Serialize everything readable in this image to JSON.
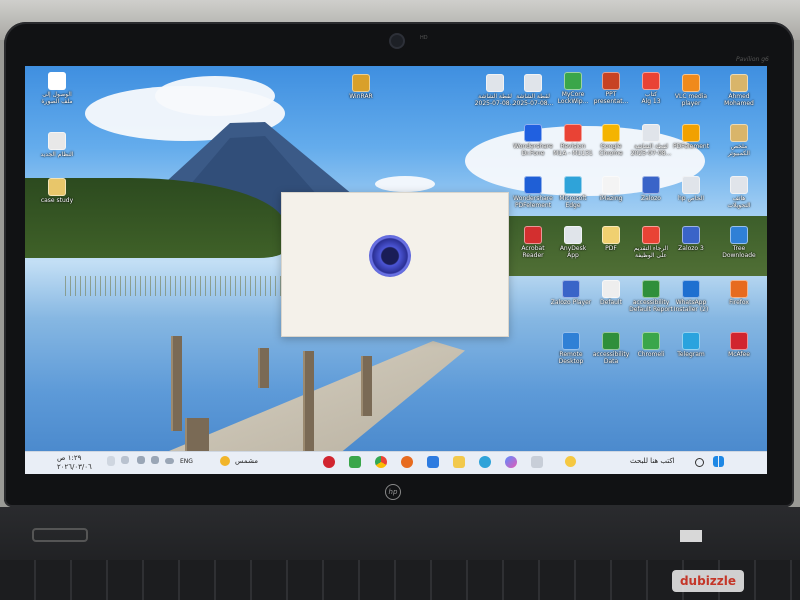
{
  "desktop": {
    "icons": [
      {
        "label": "الوصول إلى\nملف الصورة",
        "color": "#ffffff",
        "icon": "user-circle-icon"
      },
      {
        "label": "WinRAR",
        "color": "#d9a02a",
        "icon": "winrar-icon"
      },
      {
        "label": "لقطة الشاشة\n2025-07-08...",
        "color": "#e0e4ea",
        "icon": "screenshot-icon"
      },
      {
        "label": "لقطة الشاشة\n2025-07-08...",
        "color": "#e0e4ea",
        "icon": "screenshot-icon"
      },
      {
        "label": "MyCore\nLockWip...",
        "color": "#3aa64a",
        "icon": "app-icon"
      },
      {
        "label": "PPT\npresentat...",
        "color": "#c74224",
        "icon": "powerpoint-icon"
      },
      {
        "label": "كتاب\nAlg 13",
        "color": "#e94335",
        "icon": "pdf-icon"
      },
      {
        "label": "VLC media\nplayer",
        "color": "#f08a1c",
        "icon": "vlc-icon"
      },
      {
        "label": "Ahmed\nMohamed",
        "color": "#d9b56a",
        "icon": "folder-icon"
      },
      {
        "label": "النظام الجديد",
        "color": "#e8e8e8",
        "icon": "document-icon"
      },
      {
        "label": "Wondershare\nDr.Fone",
        "color": "#2060e0",
        "icon": "drfone-icon"
      },
      {
        "label": "Revision\nM1A - M1131",
        "color": "#e94335",
        "icon": "pdf-icon"
      },
      {
        "label": "Google\nChrome",
        "color": "#f4b400",
        "icon": "chrome-icon"
      },
      {
        "label": "لقطة الشاشة\n2025-07-08...",
        "color": "#e0e4ea",
        "icon": "screenshot-icon"
      },
      {
        "label": "PDFelement",
        "color": "#f1a100",
        "icon": "pdfelement-icon"
      },
      {
        "label": "ملخص\nالكمبيوتر",
        "color": "#d9b56a",
        "icon": "folder-icon"
      },
      {
        "label": "case study",
        "color": "#e8c66a",
        "icon": "folder-icon"
      },
      {
        "label": "Wondershare\nPDFelement",
        "color": "#1f5fd6",
        "icon": "pdfelement-icon"
      },
      {
        "label": "Microsoft\nEdge",
        "color": "#2fa3d9",
        "icon": "edge-icon"
      },
      {
        "label": "iMazing",
        "color": "#f4f4f4",
        "icon": "imazing-icon"
      },
      {
        "label": "Zalozo",
        "color": "#3a64c8",
        "icon": "app-icon"
      },
      {
        "label": "hp الخاص",
        "color": "#e0e4ea",
        "icon": "document-icon"
      },
      {
        "label": "هاتف\nالتحويلات",
        "color": "#e0e4ea",
        "icon": "document-icon"
      },
      {
        "label": "Acrobat\nReader",
        "color": "#d32f2f",
        "icon": "acrobat-icon"
      },
      {
        "label": "AnyDesk\nApp",
        "color": "#e0e4ea",
        "icon": "document-icon"
      },
      {
        "label": "PDF",
        "color": "#f0d070",
        "icon": "folder-icon"
      },
      {
        "label": "الرجاء التقديم\nعلى الوظيفة",
        "color": "#e94335",
        "icon": "pdf-icon"
      },
      {
        "label": "Zalozo 3",
        "color": "#3a64c8",
        "icon": "app-icon"
      },
      {
        "label": "Tree\nDownloade",
        "color": "#2f80d6",
        "icon": "download-icon"
      },
      {
        "label": "Zalozo Player",
        "color": "#3a64c8",
        "icon": "app-icon"
      },
      {
        "label": "Default",
        "color": "#eeeeee",
        "icon": "document-icon"
      },
      {
        "label": "accessibility\nDefault Report",
        "color": "#2f8f3a",
        "icon": "excel-icon"
      },
      {
        "label": "WhatsApp\nInstaller (2)",
        "color": "#1e6fd0",
        "icon": "download-icon"
      },
      {
        "label": "Firefox",
        "color": "#e76b1f",
        "icon": "firefox-icon"
      },
      {
        "label": "Remote\nDesktop",
        "color": "#2f80d6",
        "icon": "remote-icon"
      },
      {
        "label": "accessibility\nData",
        "color": "#2f8f3a",
        "icon": "excel-icon"
      },
      {
        "label": "Chromeli",
        "color": "#3aa64a",
        "icon": "app-icon"
      },
      {
        "label": "Telegram",
        "color": "#2aa3de",
        "icon": "telegram-icon"
      },
      {
        "label": "McAfee",
        "color": "#d1252f",
        "icon": "mcafee-icon"
      }
    ]
  },
  "taskbar": {
    "time": "١:٢٩ ص",
    "date": "٢٠٢٦/٠٣/٠٦",
    "weather": "مشمس",
    "search": "اكتب هنا للبحث",
    "language": "ENG"
  },
  "laptop": {
    "model": "Pavilion g6",
    "camera_label": "HD",
    "brand": "hp",
    "watermark": "dubizzle"
  },
  "colors": {
    "bezel": "#111214",
    "taskbar": "#e9eef6",
    "splash": "#f4f1ea"
  }
}
